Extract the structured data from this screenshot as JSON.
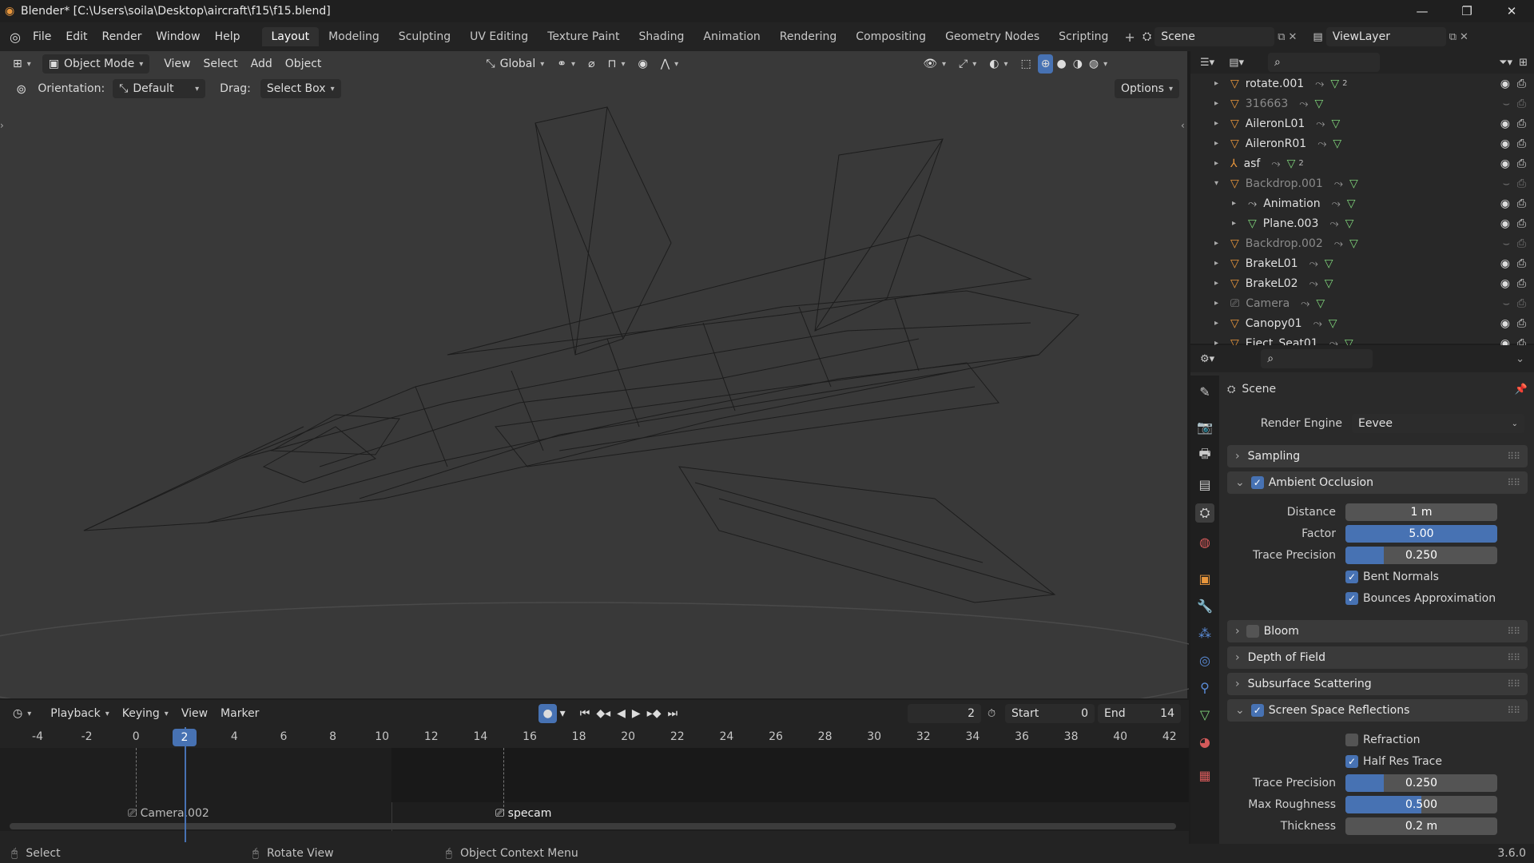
{
  "window": {
    "title": "Blender* [C:\\Users\\soila\\Desktop\\aircraft\\f15\\f15.blend]",
    "minimize": "—",
    "maximize": "❐",
    "close": "✕"
  },
  "menu": [
    "File",
    "Edit",
    "Render",
    "Window",
    "Help"
  ],
  "workspaces": [
    "Layout",
    "Modeling",
    "Sculpting",
    "UV Editing",
    "Texture Paint",
    "Shading",
    "Animation",
    "Rendering",
    "Compositing",
    "Geometry Nodes",
    "Scripting"
  ],
  "scene": {
    "name": "Scene",
    "viewlayer": "ViewLayer"
  },
  "viewport": {
    "mode": "Object Mode",
    "menus": [
      "View",
      "Select",
      "Add",
      "Object"
    ],
    "transform": "Global",
    "orientation_label": "Orientation:",
    "orientation": "Default",
    "drag_label": "Drag:",
    "drag": "Select Box",
    "options": "Options"
  },
  "timeline": {
    "menus": [
      "Playback",
      "Keying",
      "View",
      "Marker"
    ],
    "current_frame": "2",
    "start_label": "Start",
    "start": "0",
    "end_label": "End",
    "end": "14",
    "ticks": [
      "-4",
      "-2",
      "0",
      "2",
      "4",
      "6",
      "8",
      "10",
      "12",
      "14",
      "16",
      "18",
      "20",
      "22",
      "24",
      "26",
      "28",
      "30",
      "32",
      "34",
      "36",
      "38",
      "40",
      "42"
    ],
    "markers": [
      "Camera.002",
      "specam"
    ]
  },
  "outliner": {
    "rows": [
      {
        "name": "rotate.001",
        "dim": false,
        "badge": "2"
      },
      {
        "name": "316663",
        "dim": true
      },
      {
        "name": "AileronL01",
        "dim": false
      },
      {
        "name": "AileronR01",
        "dim": false
      },
      {
        "name": "asf",
        "dim": false,
        "badge": "2"
      },
      {
        "name": "Backdrop.001",
        "dim": true
      },
      {
        "name": "Animation",
        "dim": false
      },
      {
        "name": "Plane.003",
        "dim": false
      },
      {
        "name": "Backdrop.002",
        "dim": true
      },
      {
        "name": "BrakeL01",
        "dim": false
      },
      {
        "name": "BrakeL02",
        "dim": false
      },
      {
        "name": "Camera",
        "dim": true
      },
      {
        "name": "Canopy01",
        "dim": false
      },
      {
        "name": "Eject_Seat01",
        "dim": false
      }
    ]
  },
  "properties": {
    "context": "Scene",
    "render_engine_label": "Render Engine",
    "render_engine": "Eevee",
    "panels": {
      "sampling": "Sampling",
      "ao": "Ambient Occlusion",
      "bloom": "Bloom",
      "dof": "Depth of Field",
      "sss": "Subsurface Scattering",
      "ssr": "Screen Space Reflections"
    },
    "ao": {
      "distance_label": "Distance",
      "distance": "1 m",
      "factor_label": "Factor",
      "factor": "5.00",
      "factor_fill": 1.0,
      "trace_label": "Trace Precision",
      "trace": "0.250",
      "trace_fill": 0.25,
      "bent_normals": "Bent Normals",
      "bounces": "Bounces Approximation"
    },
    "ssr": {
      "refraction": "Refraction",
      "half_res": "Half Res Trace",
      "trace_label": "Trace Precision",
      "trace": "0.250",
      "trace_fill": 0.25,
      "roughness_label": "Max Roughness",
      "roughness": "0.500",
      "roughness_fill": 0.5,
      "thickness_label": "Thickness",
      "thickness": "0.2 m"
    }
  },
  "status": {
    "select": "Select",
    "rotate": "Rotate View",
    "context": "Object Context Menu",
    "version": "3.6.0"
  },
  "colors": {
    "accent": "#4772b3",
    "object_orange": "#e8963c",
    "mesh_green": "#7fd37a"
  }
}
